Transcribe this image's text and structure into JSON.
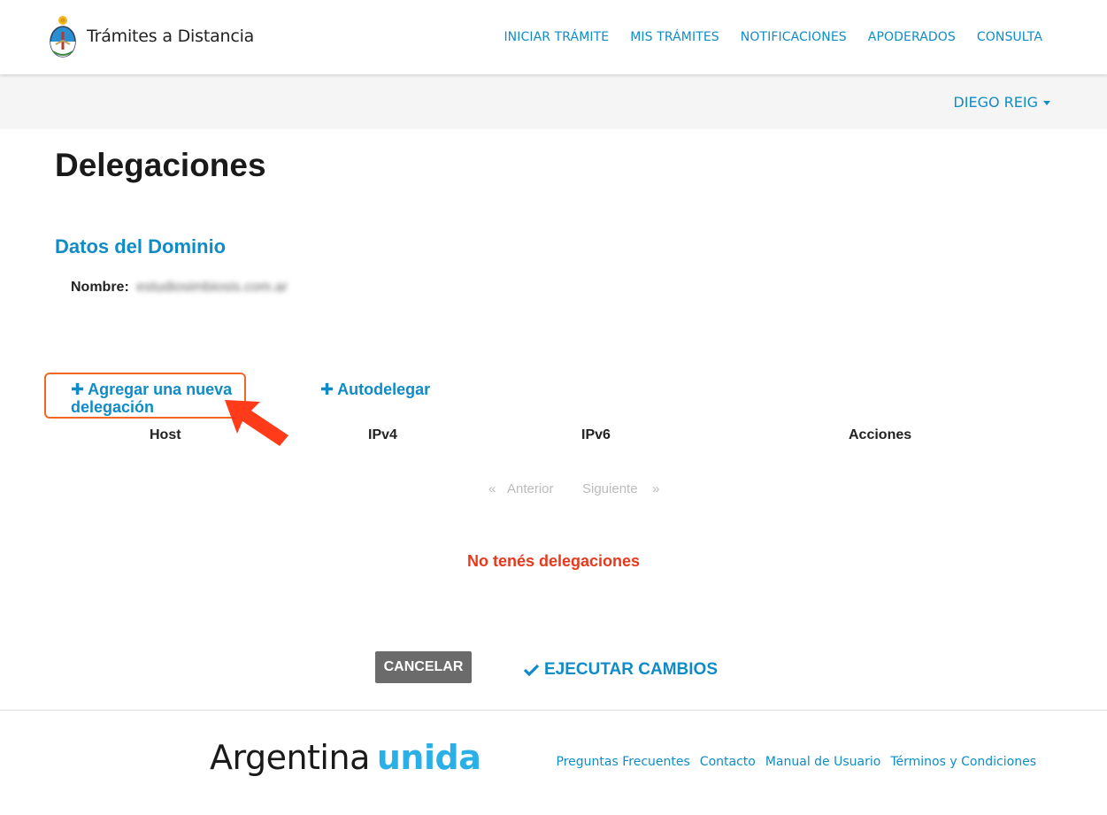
{
  "header": {
    "site_name": "Trámites a Distancia",
    "nav": [
      {
        "label": "INICIAR TRÁMITE"
      },
      {
        "label": "MIS TRÁMITES"
      },
      {
        "label": "NOTIFICACIONES"
      },
      {
        "label": "APODERADOS"
      },
      {
        "label": "CONSULTA"
      }
    ]
  },
  "user": {
    "name": "DIEGO REIG"
  },
  "page": {
    "title": "Delegaciones"
  },
  "domain": {
    "section_title": "Datos del Dominio",
    "name_label": "Nombre:",
    "name_value": "estudiosimbiosis.com.ar"
  },
  "actions": {
    "add_delegation": "Agregar una nueva delegación",
    "auto_delegate": "Autodelegar"
  },
  "table": {
    "columns": [
      "Host",
      "IPv4",
      "IPv6",
      "Acciones"
    ]
  },
  "pagination": {
    "prev_symbol": "«",
    "prev": "Anterior",
    "next": "Siguiente",
    "next_symbol": "»"
  },
  "empty_message": "No tenés delegaciones",
  "buttons": {
    "cancel": "CANCELAR",
    "execute": "EJECUTAR CAMBIOS"
  },
  "footer": {
    "logo_part1": "Argentina",
    "logo_part2": "unida",
    "links": [
      "Preguntas Frecuentes",
      "Contacto",
      "Manual de Usuario",
      "Términos y Condiciones"
    ]
  },
  "colors": {
    "accent": "#0f8cc7",
    "highlight": "#f26722",
    "error": "#e8391c"
  }
}
